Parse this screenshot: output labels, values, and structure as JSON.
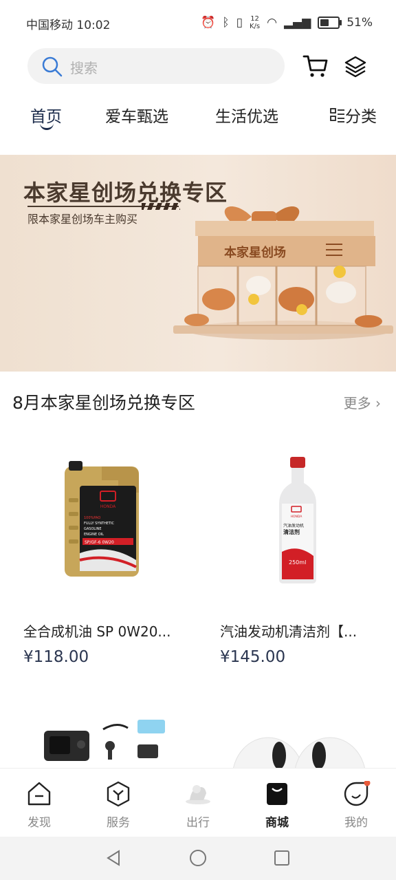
{
  "status": {
    "carrier_time": "中国移动 10:02",
    "net_speed": "12\nK/s",
    "net_top": "12",
    "net_unit": "K/s",
    "battery": "51%",
    "battery_level": 0.51
  },
  "search": {
    "placeholder": "搜索"
  },
  "tabs": [
    {
      "label": "首页",
      "active": true
    },
    {
      "label": "爱车甄选"
    },
    {
      "label": "生活优选"
    },
    {
      "label": "分类"
    }
  ],
  "banner": {
    "title": "本家星创场兑换专区",
    "subtitle": "限本家星创场车主购买",
    "sign_text": "本家星创场"
  },
  "section": {
    "title": "8月本家星创场兑换专区",
    "more": "更多"
  },
  "products": [
    {
      "name": "全合成机油 SP 0W20...",
      "price": "¥118.00",
      "label_lines": [
        "100%PAO",
        "FULLY SYNTHETIC",
        "GASOLINE",
        "ENGINE OIL",
        "SP/GF-6  0W20"
      ]
    },
    {
      "name": "汽油发动机清洁剂【...",
      "price": "¥145.00",
      "label_lines": [
        "汽油发动机",
        "清洁剂",
        "250ml"
      ]
    }
  ],
  "nav": [
    {
      "label": "发现",
      "icon": "home-icon"
    },
    {
      "label": "服务",
      "icon": "service-icon"
    },
    {
      "label": "出行",
      "icon": "travel-icon"
    },
    {
      "label": "商城",
      "icon": "mall-icon",
      "active": true
    },
    {
      "label": "我的",
      "icon": "profile-icon",
      "badge": true
    }
  ],
  "colors": {
    "accent": "#1a2a4a",
    "price": "#2b3650",
    "banner_bg": "#f2e4d6",
    "badge": "#e85a3a"
  }
}
